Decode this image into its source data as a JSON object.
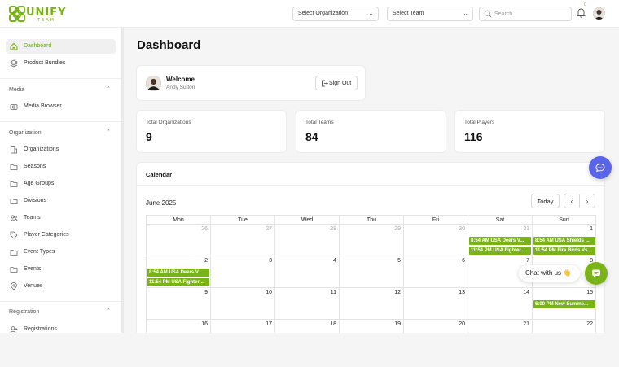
{
  "app": {
    "logo_text": "UNIFY",
    "logo_sub": "TEAM",
    "brand_color": "#7ab317",
    "accent_blue": "#5a64e8"
  },
  "topbar": {
    "select_organization": "Select Organization",
    "select_team": "Select Team",
    "search_placeholder": "Search",
    "notification_count": "0"
  },
  "sidebar": {
    "items_top": [
      {
        "label": "Dashboard",
        "icon": "home-icon",
        "active": true
      },
      {
        "label": "Product Bundles",
        "icon": "layers-icon"
      }
    ],
    "sections": [
      {
        "title": "Media",
        "items": [
          {
            "label": "Media Browser",
            "icon": "camera-icon"
          }
        ]
      },
      {
        "title": "Organization",
        "items": [
          {
            "label": "Organizations",
            "icon": "building-icon"
          },
          {
            "label": "Seasons",
            "icon": "folder-icon"
          },
          {
            "label": "Age Groups",
            "icon": "folder-icon"
          },
          {
            "label": "Divisions",
            "icon": "folder-icon"
          },
          {
            "label": "Teams",
            "icon": "users-icon"
          },
          {
            "label": "Player Categories",
            "icon": "tag-icon"
          },
          {
            "label": "Event Types",
            "icon": "folder-icon"
          },
          {
            "label": "Events",
            "icon": "folder-icon"
          },
          {
            "label": "Venues",
            "icon": "pin-icon"
          }
        ]
      },
      {
        "title": "Registration",
        "items": [
          {
            "label": "Registrations",
            "icon": "user-add-icon"
          }
        ]
      }
    ]
  },
  "main": {
    "title": "Dashboard",
    "welcome": {
      "title": "Welcome",
      "name": "Andy Sutton",
      "signout_label": "Sign Out"
    },
    "stats": [
      {
        "label": "Total Organizations",
        "value": "9"
      },
      {
        "label": "Total Teams",
        "value": "84"
      },
      {
        "label": "Total Players",
        "value": "116"
      }
    ],
    "calendar": {
      "heading": "Calendar",
      "month": "June 2025",
      "today_label": "Today",
      "prev_label": "‹",
      "next_label": "›",
      "weekdays": [
        "Mon",
        "Tue",
        "Wed",
        "Thu",
        "Fri",
        "Sat",
        "Sun"
      ],
      "weeks": [
        [
          {
            "d": "26",
            "m": true
          },
          {
            "d": "27",
            "m": true
          },
          {
            "d": "28",
            "m": true
          },
          {
            "d": "29",
            "m": true
          },
          {
            "d": "30",
            "m": true
          },
          {
            "d": "31",
            "m": true,
            "events": [
              "8:54 AM USA Deers V...",
              "11:54 PM USA Fighter ..."
            ]
          },
          {
            "d": "1",
            "events": [
              "8:54 AM USA Shields ...",
              "11:54 PM Fire Birds Vs..."
            ]
          }
        ],
        [
          {
            "d": "2",
            "events": [
              "8:54 AM USA Deers V...",
              "11:54 PM USA Fighter ..."
            ]
          },
          {
            "d": "3"
          },
          {
            "d": "4"
          },
          {
            "d": "5"
          },
          {
            "d": "6"
          },
          {
            "d": "7"
          },
          {
            "d": "8"
          }
        ],
        [
          {
            "d": "9"
          },
          {
            "d": "10"
          },
          {
            "d": "11"
          },
          {
            "d": "12"
          },
          {
            "d": "13"
          },
          {
            "d": "14"
          },
          {
            "d": "15",
            "events": [
              "6:00 PM New Summe..."
            ]
          }
        ],
        [
          {
            "d": "16"
          },
          {
            "d": "17"
          },
          {
            "d": "18"
          },
          {
            "d": "19"
          },
          {
            "d": "20"
          },
          {
            "d": "21"
          },
          {
            "d": "22"
          }
        ]
      ]
    }
  },
  "chat": {
    "label": "Chat with us 👋"
  }
}
